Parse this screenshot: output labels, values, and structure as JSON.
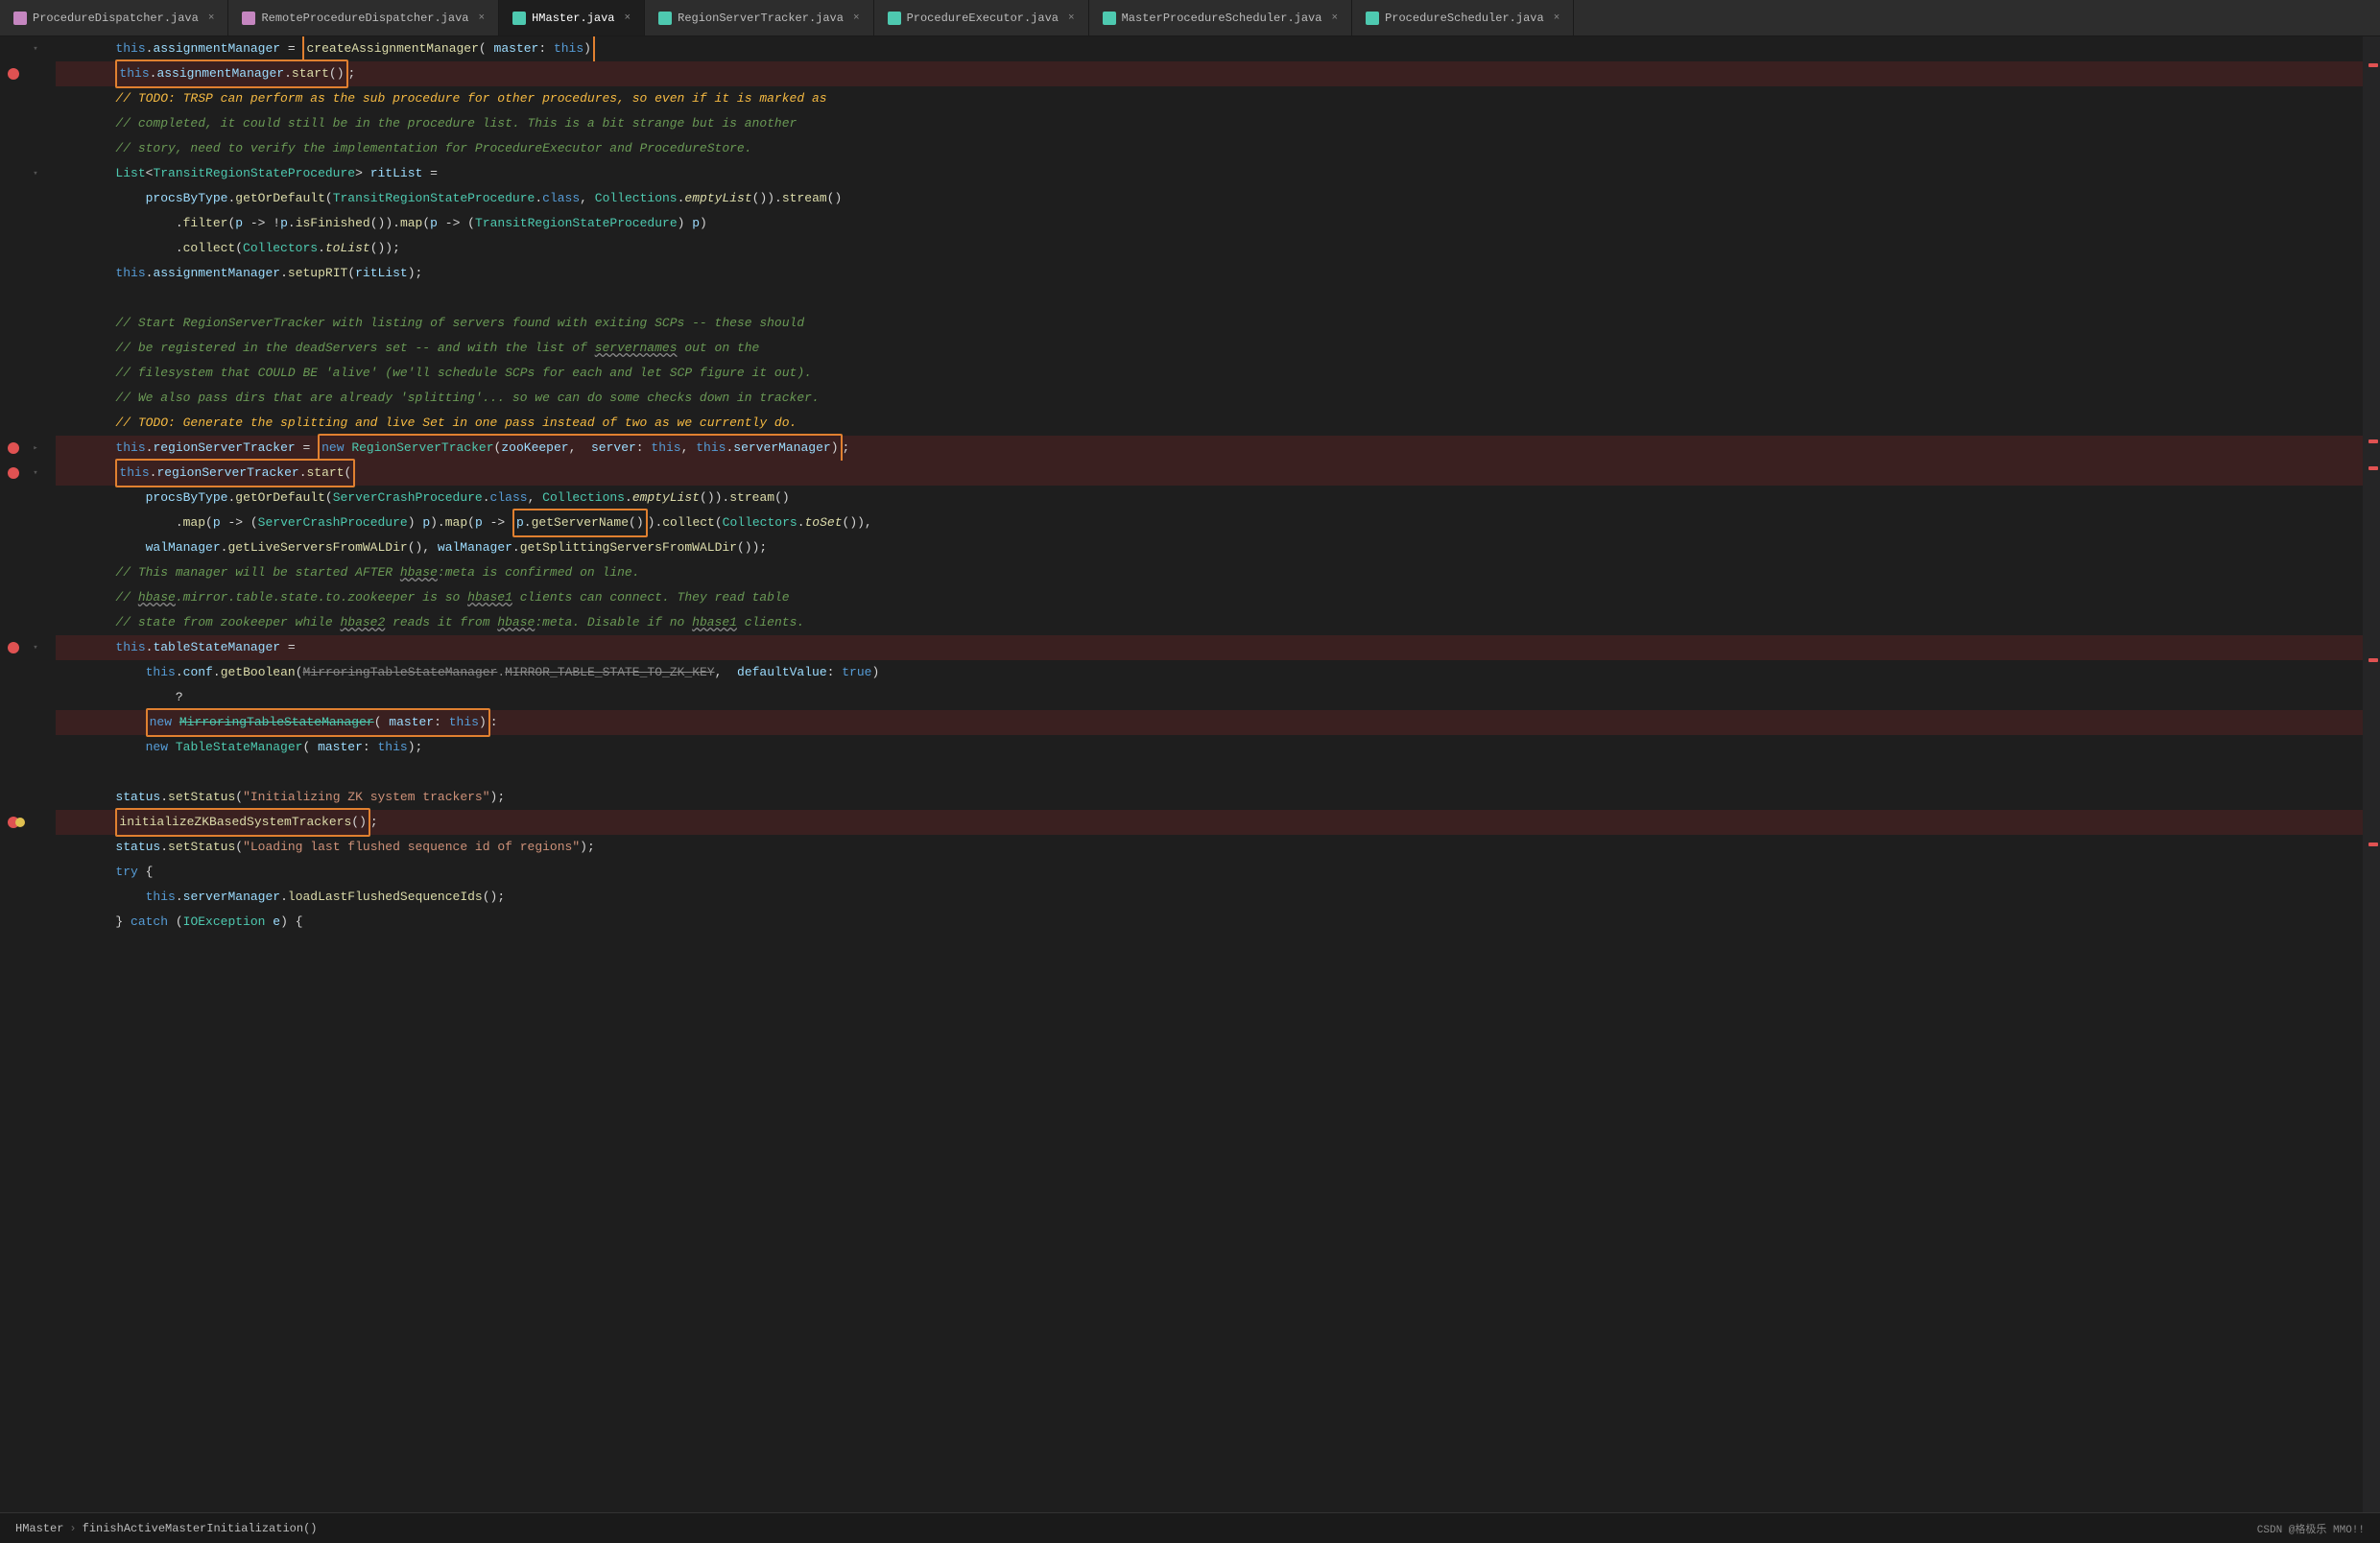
{
  "tabs": [
    {
      "id": "tab1",
      "label": "ProcedureDispatcher.java",
      "icon_color": "#c586c0",
      "active": false,
      "closeable": true
    },
    {
      "id": "tab2",
      "label": "RemoteProcedureDispatcher.java",
      "icon_color": "#c586c0",
      "active": false,
      "closeable": true
    },
    {
      "id": "tab3",
      "label": "HMaster.java",
      "icon_color": "#4ec9b0",
      "active": true,
      "closeable": true
    },
    {
      "id": "tab4",
      "label": "RegionServerTracker.java",
      "icon_color": "#4ec9b0",
      "active": false,
      "closeable": true
    },
    {
      "id": "tab5",
      "label": "ProcedureExecutor.java",
      "icon_color": "#4ec9b0",
      "active": false,
      "closeable": true
    },
    {
      "id": "tab6",
      "label": "MasterProcedureScheduler.java",
      "icon_color": "#4ec9b0",
      "active": false,
      "closeable": true
    },
    {
      "id": "tab7",
      "label": "ProcedureScheduler.java",
      "icon_color": "#4ec9b0",
      "active": false,
      "closeable": true
    }
  ],
  "status_bar": {
    "breadcrumb_file": "HMaster",
    "breadcrumb_method": "finishActiveMasterInitialization()",
    "csdn_badge": "CSDN @格极乐 MMO!!"
  },
  "code": {
    "lines": [
      {
        "num": "",
        "has_breakpoint": false,
        "content": "        this.assignmentManager = createAssignmentManager( master: this)"
      },
      {
        "num": "",
        "has_breakpoint": true,
        "content": "        this.assignmentManager.start();"
      },
      {
        "num": "",
        "has_breakpoint": false,
        "content": "        // TODO: TRSP can perform as the sub procedure for other procedures, so even if it is marked as"
      },
      {
        "num": "",
        "has_breakpoint": false,
        "content": "        // completed, it could still be in the procedure list. This is a bit strange but is another"
      },
      {
        "num": "",
        "has_breakpoint": false,
        "content": "        // story, need to verify the implementation for ProcedureExecutor and ProcedureStore."
      },
      {
        "num": "",
        "has_breakpoint": false,
        "content": "        List<TransitRegionStateProcedure> ritList ="
      },
      {
        "num": "",
        "has_breakpoint": false,
        "content": "            procsByType.getOrDefault(TransitRegionStateProcedure.class, Collections.emptyList()).stream()"
      },
      {
        "num": "",
        "has_breakpoint": false,
        "content": "                .filter(p -> !p.isFinished()).map(p -> (TransitRegionStateProcedure) p)"
      },
      {
        "num": "",
        "has_breakpoint": false,
        "content": "                .collect(Collectors.toList());"
      },
      {
        "num": "",
        "has_breakpoint": false,
        "content": "        this.assignmentManager.setupRIT(ritList);"
      },
      {
        "num": "",
        "has_breakpoint": false,
        "content": ""
      },
      {
        "num": "",
        "has_breakpoint": false,
        "content": "        // Start RegionServerTracker with listing of servers found with exiting SCPs -- these should"
      },
      {
        "num": "",
        "has_breakpoint": false,
        "content": "        // be registered in the deadServers set -- and with the list of servernames out on the"
      },
      {
        "num": "",
        "has_breakpoint": false,
        "content": "        // filesystem that COULD BE 'alive' (we'll schedule SCPs for each and let SCP figure it out)."
      },
      {
        "num": "",
        "has_breakpoint": false,
        "content": "        // We also pass dirs that are already 'splitting'... so we can do some checks down in tracker."
      },
      {
        "num": "",
        "has_breakpoint": false,
        "content": "        // TODO: Generate the splitting and live Set in one pass instead of two as we currently do."
      },
      {
        "num": "",
        "has_breakpoint": true,
        "content": "        this.regionServerTracker = new RegionServerTracker(zooKeeper,  server: this,  this.serverManager);"
      },
      {
        "num": "",
        "has_breakpoint": true,
        "content": "        this.regionServerTracker.start("
      },
      {
        "num": "",
        "has_breakpoint": false,
        "content": "            procsByType.getOrDefault(ServerCrashProcedure.class, Collections.emptyList()).stream()"
      },
      {
        "num": "",
        "has_breakpoint": false,
        "content": "                .map(p -> (ServerCrashProcedure) p).map(p -> p.getServerName()).collect(Collectors.toSet()),"
      },
      {
        "num": "",
        "has_breakpoint": false,
        "content": "            walManager.getLiveServersFromWALDir(), walManager.getSplittingServersFromWALDir());"
      },
      {
        "num": "",
        "has_breakpoint": false,
        "content": "        // This manager will be started AFTER hbase:meta is confirmed on line."
      },
      {
        "num": "",
        "has_breakpoint": false,
        "content": "        // hbase.mirror.table.state.to.zookeeper is so hbase1 clients can connect. They read table"
      },
      {
        "num": "",
        "has_breakpoint": false,
        "content": "        // state from zookeeper while hbase2 reads it from hbase:meta. Disable if no hbase1 clients."
      },
      {
        "num": "",
        "has_breakpoint": true,
        "content": "        this.tableStateManager ="
      },
      {
        "num": "",
        "has_breakpoint": false,
        "content": "            this.conf.getBoolean(MirroringTableStateManager.MIRROR_TABLE_STATE_TO_ZK_KEY,  defaultValue: true)"
      },
      {
        "num": "",
        "has_breakpoint": false,
        "content": "                ?"
      },
      {
        "num": "",
        "has_breakpoint": false,
        "content": "            new MirroringTableStateManager( master: this):"
      },
      {
        "num": "",
        "has_breakpoint": false,
        "content": "            new TableStateManager( master: this);"
      },
      {
        "num": "",
        "has_breakpoint": false,
        "content": ""
      },
      {
        "num": "",
        "has_breakpoint": false,
        "content": "        status.setStatus(\"Initializing ZK system trackers\");"
      },
      {
        "num": "",
        "has_breakpoint": true,
        "content": "        initializeZKBasedSystemTrackers();"
      },
      {
        "num": "",
        "has_breakpoint": false,
        "content": "        status.setStatus(\"Loading last flushed sequence id of regions\");"
      },
      {
        "num": "",
        "has_breakpoint": false,
        "content": "        try {"
      },
      {
        "num": "",
        "has_breakpoint": false,
        "content": "            this.serverManager.loadLastFlushedSequenceIds();"
      },
      {
        "num": "",
        "has_breakpoint": false,
        "content": "        } catch (IOException e) {"
      }
    ]
  },
  "colors": {
    "bg": "#1e1e1e",
    "tab_active_bg": "#1e1e1e",
    "tab_inactive_bg": "#2d2d2d",
    "gutter_bg": "#1e1e1e",
    "highlight_line_bg": "#3a2020",
    "debug_box_border": "#e08030",
    "breakpoint_red": "#e05252",
    "breakpoint_yellow": "#e0c050",
    "comment_green": "#6a9955",
    "keyword_blue": "#569cd6",
    "type_teal": "#4ec9b0",
    "field_light_blue": "#9cdcfe",
    "method_yellow": "#dcdcaa",
    "string_orange": "#ce9178",
    "operator_white": "#d4d4d4"
  }
}
